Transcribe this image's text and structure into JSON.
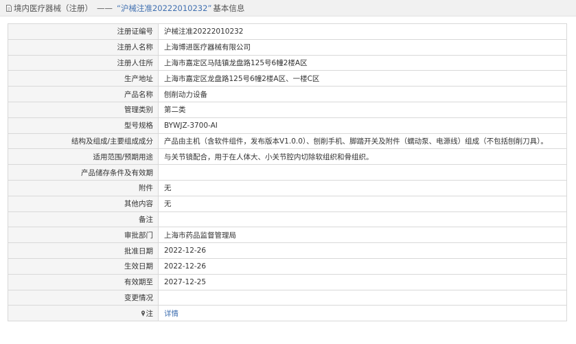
{
  "header": {
    "breadcrumb": "境内医疗器械（注册）",
    "separator": "——",
    "title": "“沪械注准20222010232”",
    "tail": "基本信息"
  },
  "rows": [
    {
      "label": "注册证编号",
      "value": "沪械注准20222010232"
    },
    {
      "label": "注册人名称",
      "value": "上海博进医疗器械有限公司"
    },
    {
      "label": "注册人住所",
      "value": "上海市嘉定区马陆镇龙盘路125号6幢2楼A区"
    },
    {
      "label": "生产地址",
      "value": "上海市嘉定区龙盘路125号6幢2楼A区、一楼C区"
    },
    {
      "label": "产品名称",
      "value": "刨削动力设备"
    },
    {
      "label": "管理类别",
      "value": "第二类"
    },
    {
      "label": "型号规格",
      "value": "BYWJZ-3700-AⅠ"
    },
    {
      "label": "结构及组成/主要组成成分",
      "value": "产品由主机（含软件组件，发布版本V1.0.0）、刨削手机、脚踏开关及附件（蠕动泵、电源线）组成（不包括刨削刀具）。"
    },
    {
      "label": "适用范围/预期用途",
      "value": "与关节镜配合，用于在人体大、小关节腔内切除软组织和骨组织。"
    },
    {
      "label": "产品储存条件及有效期",
      "value": ""
    },
    {
      "label": "附件",
      "value": "无"
    },
    {
      "label": "其他内容",
      "value": "无"
    },
    {
      "label": "备注",
      "value": ""
    },
    {
      "label": "审批部门",
      "value": "上海市药品监督管理局"
    },
    {
      "label": "批准日期",
      "value": "2022-12-26"
    },
    {
      "label": "生效日期",
      "value": "2022-12-26"
    },
    {
      "label": "有效期至",
      "value": "2027-12-25"
    },
    {
      "label": "变更情况",
      "value": ""
    },
    {
      "label": "注",
      "value": "详情",
      "icon": "pin-icon"
    }
  ]
}
